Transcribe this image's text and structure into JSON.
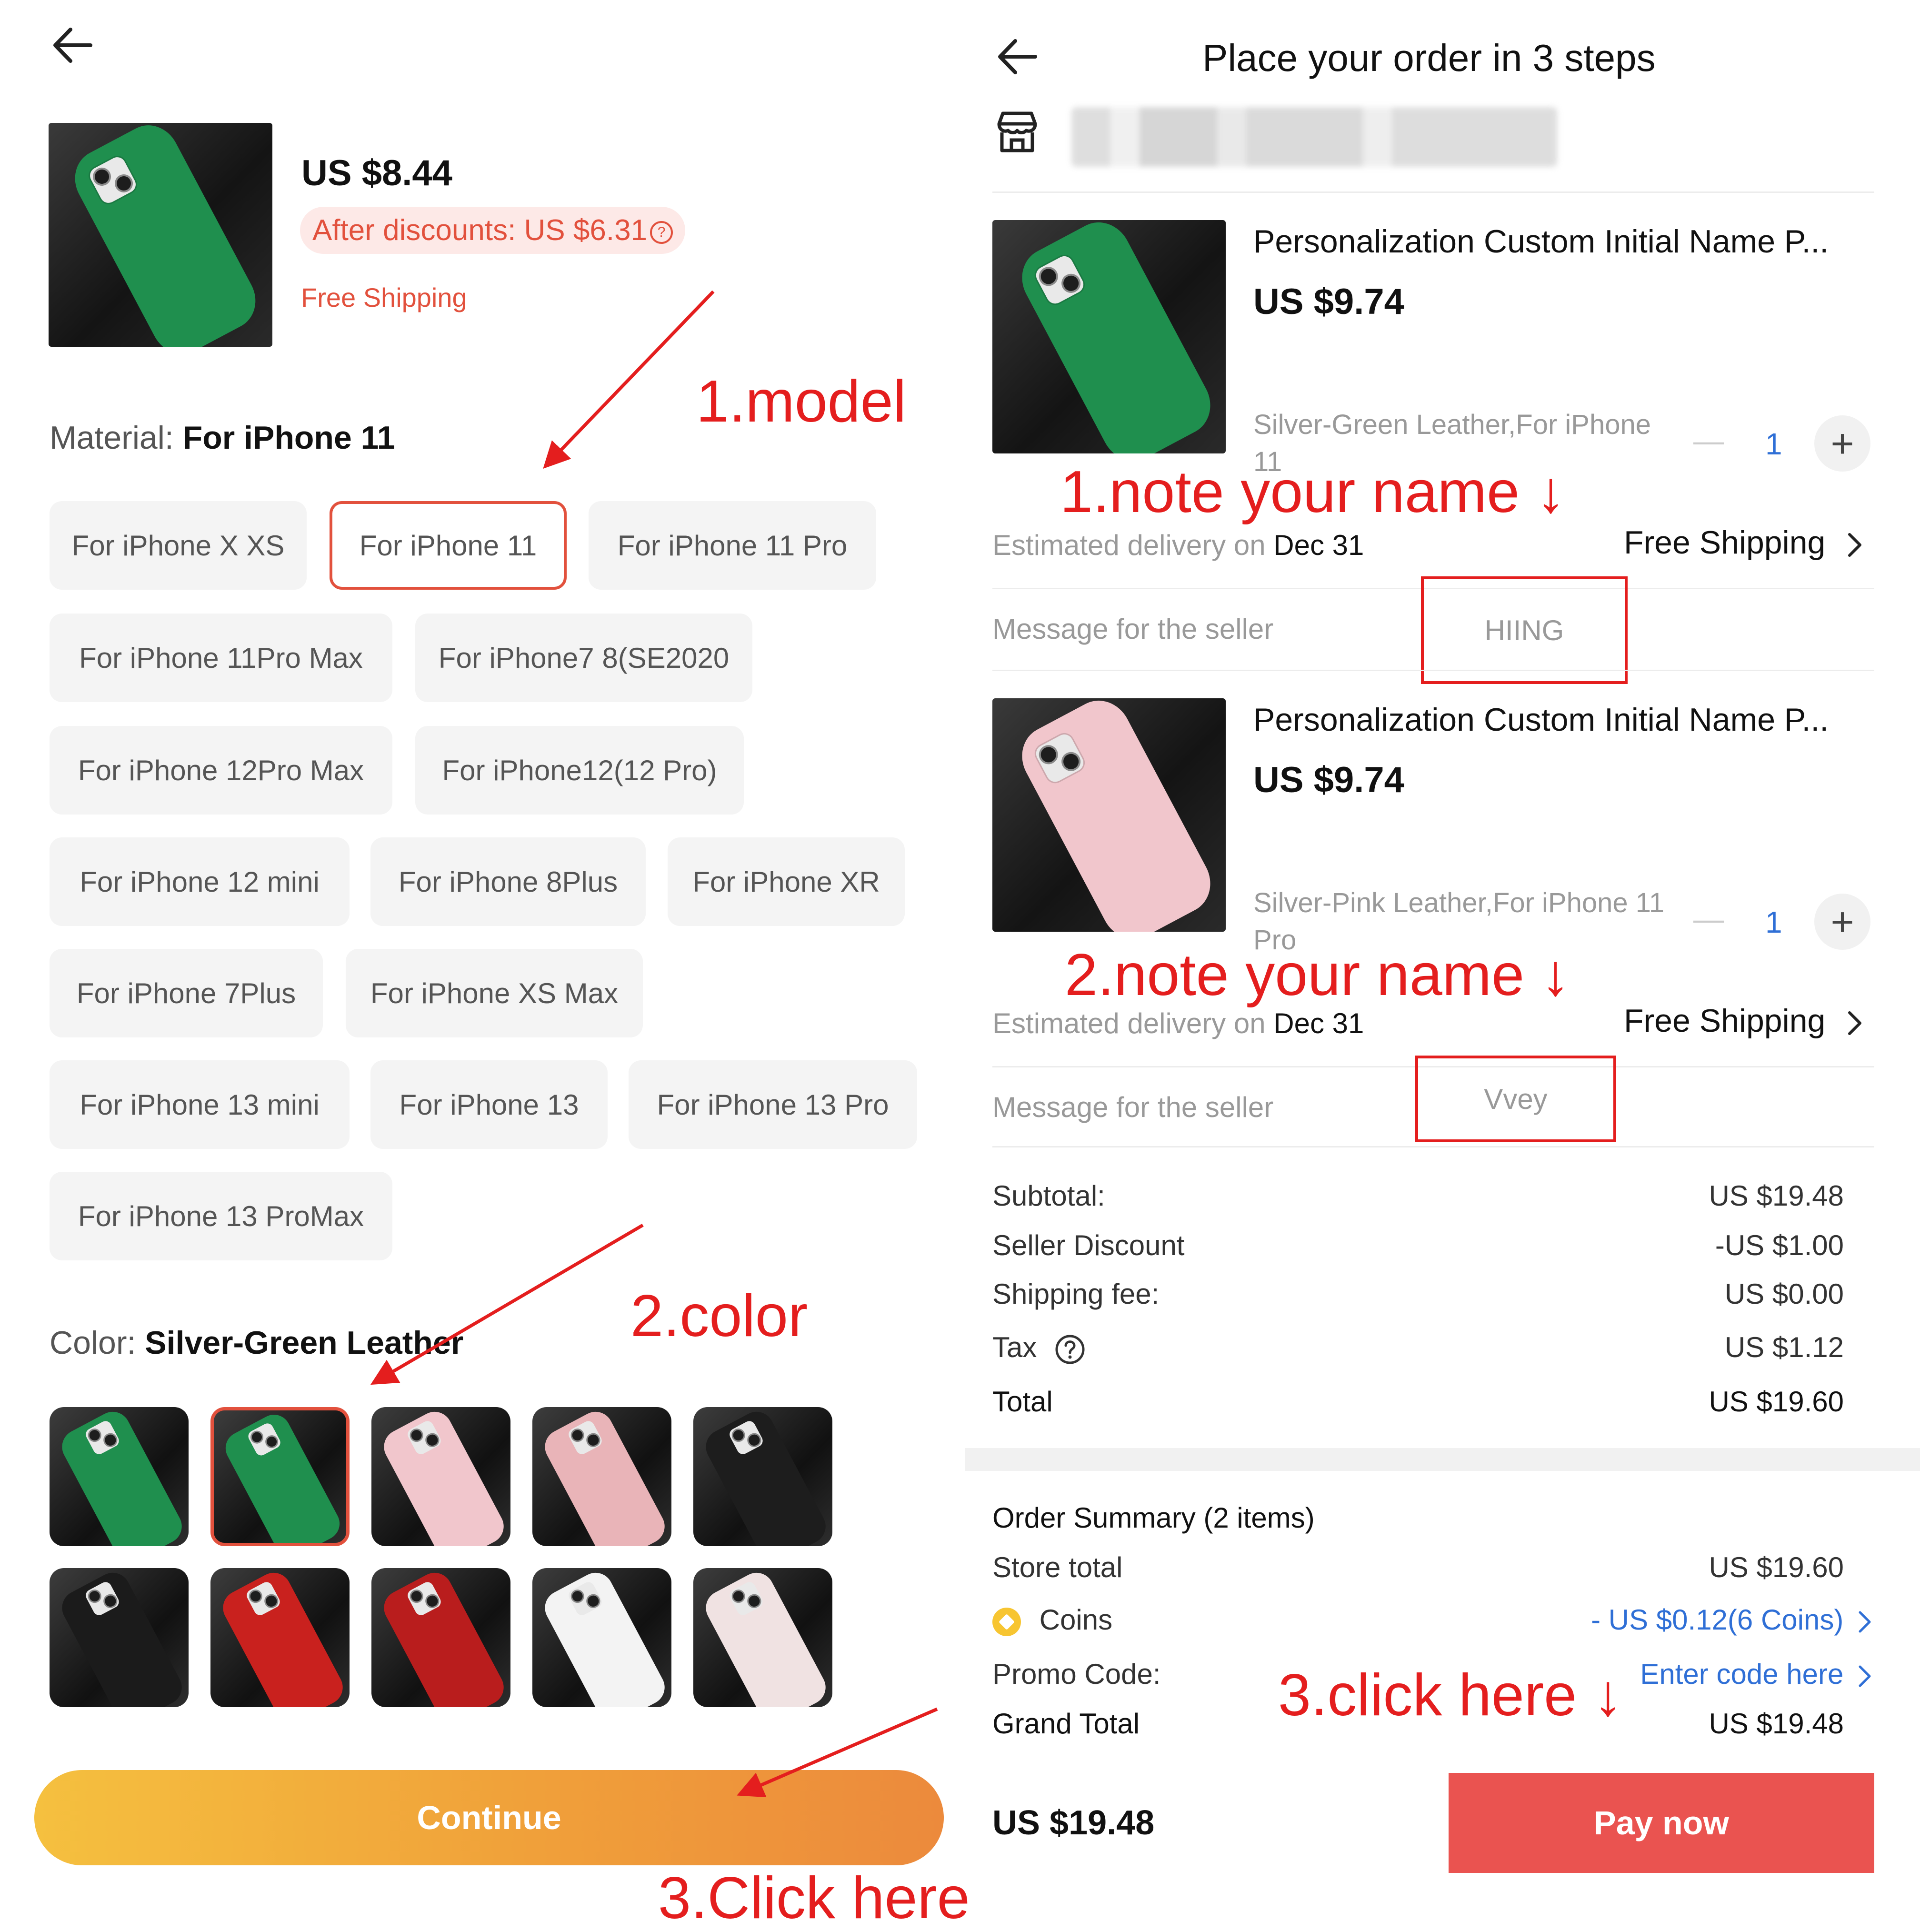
{
  "left": {
    "product": {
      "price": "US $8.44",
      "discount": "After discounts: US $6.31",
      "shipping": "Free Shipping",
      "image_color": "#1f8f4e"
    },
    "material": {
      "label": "Material:",
      "selected": "For iPhone 11",
      "options": [
        "For iPhone X XS",
        "For iPhone 11",
        "For iPhone 11 Pro",
        "For iPhone 11Pro Max",
        "For iPhone7 8(SE2020",
        "For iPhone 12Pro Max",
        "For iPhone12(12 Pro)",
        "For iPhone 12 mini",
        "For iPhone 8Plus",
        "For iPhone XR",
        "For iPhone 7Plus",
        "For iPhone XS Max",
        "For iPhone 13 mini",
        "For iPhone 13",
        "For iPhone 13 Pro",
        "For iPhone 13 ProMax"
      ]
    },
    "color": {
      "label": "Color:",
      "selected": "Silver-Green Leather",
      "swatches": [
        "#1f8f4e",
        "#1f8f4e",
        "#f1c6cc",
        "#e9b4b8",
        "#1d1d1d",
        "#1b1b1b",
        "#c9211e",
        "#b91d1d",
        "#f3f3f3",
        "#f0e2e2"
      ]
    },
    "continue_label": "Continue"
  },
  "right": {
    "title": "Place your order in 3 steps",
    "items": [
      {
        "title": "Personalization Custom Initial Name P...",
        "price": "US $9.74",
        "variant": "Silver-Green Leather,For iPhone 11",
        "qty": "1",
        "delivery_prefix": "Estimated delivery on",
        "delivery_date": "Dec 31",
        "shipping": "Free Shipping",
        "message_label": "Message for the seller",
        "message_value": "HIING",
        "image_color": "#1f8f4e"
      },
      {
        "title": "Personalization Custom Initial Name P...",
        "price": "US $9.74",
        "variant": "Silver-Pink Leather,For iPhone 11 Pro",
        "qty": "1",
        "delivery_prefix": "Estimated delivery on",
        "delivery_date": "Dec 31",
        "shipping": "Free Shipping",
        "message_label": "Message for the seller",
        "message_value": "Vvey",
        "image_color": "#f1c6cc"
      }
    ],
    "summary": {
      "subtotal_label": "Subtotal:",
      "subtotal": "US $19.48",
      "discount_label": "Seller Discount",
      "discount": "-US $1.00",
      "shipping_label": "Shipping fee:",
      "shipping": "US $0.00",
      "tax_label": "Tax",
      "tax": "US $1.12",
      "total_label": "Total",
      "total": "US $19.60"
    },
    "order_summary": {
      "heading": "Order Summary (2 items)",
      "store_total_label": "Store total",
      "store_total": "US $19.60",
      "coins_label": "Coins",
      "coins_value": "- US $0.12(6 Coins)",
      "promo_label": "Promo Code:",
      "promo_value": "Enter code here",
      "grand_total_label": "Grand Total",
      "grand_total": "US $19.48"
    },
    "bottom_total": "US $19.48",
    "pay_label": "Pay now"
  },
  "annotations": {
    "model": "1.model",
    "color": "2.color",
    "click_here_left": "3.Click here",
    "note1": "1.note your name ↓",
    "note2": "2.note your name ↓",
    "click_here_right": "3.click here ↓",
    "color_hex": "#e41e1e"
  }
}
